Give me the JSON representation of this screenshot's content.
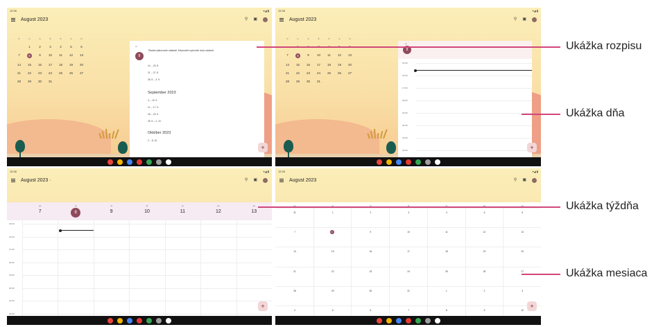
{
  "status": {
    "time": "15:36",
    "signal": "▾◢ ▮"
  },
  "panels": [
    {
      "title": "August 2023",
      "view": "schedule"
    },
    {
      "title": "August 2023",
      "view": "day"
    },
    {
      "title": "August 2023 ·",
      "view": "week"
    },
    {
      "title": "August 2023",
      "view": "month"
    }
  ],
  "minical": {
    "weekdays": [
      "P",
      "U",
      "S",
      "Š",
      "P",
      "S",
      "N"
    ],
    "rows": [
      [
        "",
        "1",
        "2",
        "3",
        "4",
        "5",
        "6"
      ],
      [
        "7",
        "8",
        "9",
        "10",
        "11",
        "12",
        "13"
      ],
      [
        "14",
        "15",
        "16",
        "17",
        "18",
        "19",
        "20"
      ],
      [
        "21",
        "22",
        "23",
        "24",
        "25",
        "26",
        "27"
      ],
      [
        "28",
        "29",
        "30",
        "31",
        "",
        "",
        ""
      ]
    ],
    "selected": "8"
  },
  "schedule": {
    "dayname": "ut",
    "daynum": "8",
    "message": "Žiadne plánované udalosti. Klepnutím vytvoríte novú udalosť.",
    "ranges1": [
      "14. – 20. 8.",
      "21. – 27. 8.",
      "28. 8. – 3. 9."
    ],
    "month2": "September 2023",
    "ranges2": [
      "4. – 10. 9.",
      "11. – 17. 9.",
      "18. – 24. 9.",
      "25. 9. – 1. 10."
    ],
    "month3": "Október 2023",
    "ranges3": [
      "2. – 8. 10."
    ]
  },
  "day": {
    "dayname": "ut",
    "daynum": "8",
    "hours": [
      "15:00",
      "16:00",
      "17:00",
      "18:00",
      "19:00",
      "20:00",
      "21:00",
      "22:00"
    ]
  },
  "week": {
    "days": [
      {
        "n": "po",
        "d": "7"
      },
      {
        "n": "ut",
        "d": "8"
      },
      {
        "n": "st",
        "d": "9"
      },
      {
        "n": "št",
        "d": "10"
      },
      {
        "n": "pi",
        "d": "11"
      },
      {
        "n": "so",
        "d": "12"
      },
      {
        "n": "ne",
        "d": "13"
      }
    ],
    "hours": [
      "15:00",
      "16:00",
      "17:00",
      "18:00",
      "19:00",
      "20:00",
      "21:00",
      "22:00"
    ]
  },
  "month": {
    "weekdays": [
      "po",
      "ut",
      "st",
      "št",
      "pi",
      "so",
      "ne"
    ],
    "rows": [
      [
        "31",
        "1",
        "2",
        "3",
        "4",
        "5",
        "6"
      ],
      [
        "7",
        "8",
        "9",
        "10",
        "11",
        "12",
        "13"
      ],
      [
        "14",
        "15",
        "16",
        "17",
        "18",
        "19",
        "20"
      ],
      [
        "21",
        "22",
        "23",
        "24",
        "25",
        "26",
        "27"
      ],
      [
        "28",
        "29",
        "30",
        "31",
        "1",
        "2",
        "3"
      ],
      [
        "4",
        "5",
        "6",
        "7",
        "8",
        "9",
        "10"
      ]
    ]
  },
  "fab": "+",
  "callouts": [
    "Ukážka rozpisu",
    "Ukážka dňa",
    "Ukážka týždňa",
    "Ukážka mesiaca"
  ],
  "colors": {
    "accent": "#8e4a5a",
    "callout": "#d1477a"
  }
}
